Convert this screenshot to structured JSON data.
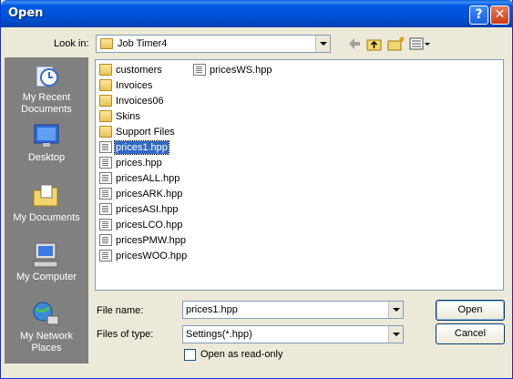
{
  "window": {
    "title": "Open",
    "help_glyph": "?",
    "close_glyph": "✕"
  },
  "lookin": {
    "label": "Look in:",
    "value": "Job Timer4"
  },
  "toolbar": {
    "icons": [
      "back-icon",
      "up-folder-icon",
      "new-folder-icon",
      "views-menu-icon"
    ]
  },
  "places": [
    {
      "label": "My Recent Documents",
      "icon": "recent-documents-icon"
    },
    {
      "label": "Desktop",
      "icon": "desktop-icon"
    },
    {
      "label": "My Documents",
      "icon": "my-documents-icon"
    },
    {
      "label": "My Computer",
      "icon": "my-computer-icon"
    },
    {
      "label": "My Network Places",
      "icon": "network-places-icon"
    }
  ],
  "files": {
    "col1": [
      {
        "name": "customers",
        "type": "folder"
      },
      {
        "name": "Invoices",
        "type": "folder"
      },
      {
        "name": "Invoices06",
        "type": "folder"
      },
      {
        "name": "Skins",
        "type": "folder"
      },
      {
        "name": "Support Files",
        "type": "folder"
      },
      {
        "name": "prices1.hpp",
        "type": "file",
        "selected": true
      },
      {
        "name": "prices.hpp",
        "type": "file"
      },
      {
        "name": "pricesALL.hpp",
        "type": "file"
      },
      {
        "name": "pricesARK.hpp",
        "type": "file"
      },
      {
        "name": "pricesASI.hpp",
        "type": "file"
      },
      {
        "name": "pricesLCO.hpp",
        "type": "file"
      },
      {
        "name": "pricesPMW.hpp",
        "type": "file"
      },
      {
        "name": "pricesWOO.hpp",
        "type": "file"
      }
    ],
    "col2": [
      {
        "name": "pricesWS.hpp",
        "type": "file"
      }
    ]
  },
  "filename": {
    "label": "File name:",
    "value": "prices1.hpp"
  },
  "filetype": {
    "label": "Files of type:",
    "value": "Settings(*.hpp)"
  },
  "readonly": {
    "label": "Open as read-only",
    "checked": false
  },
  "buttons": {
    "open": "Open",
    "cancel": "Cancel"
  }
}
